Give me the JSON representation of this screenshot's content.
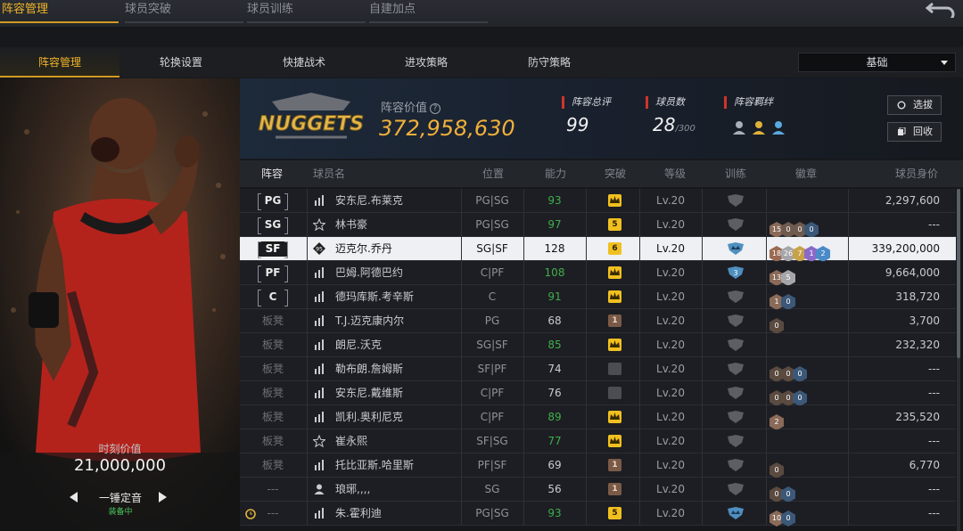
{
  "top_tabs": [
    "阵容管理",
    "球员突破",
    "球员训练",
    "自建加点"
  ],
  "sub_tabs": [
    "阵容管理",
    "轮换设置",
    "快捷战术",
    "进攻策略",
    "防守策略"
  ],
  "mode_select": {
    "value": "基础"
  },
  "card": {
    "value_label": "时刻价值",
    "value": "21,000,000",
    "skin_name": "一锤定音",
    "skin_status": "装备中"
  },
  "team": {
    "logo_text": "NUGGETS",
    "value_label": "阵容价值",
    "value": "372,958,630",
    "rating_label": "阵容总评",
    "rating": "99",
    "count_label": "球员数",
    "count": "28",
    "count_max": "/300",
    "synergy_label": "阵容羁绊",
    "btn_select": "选拔",
    "btn_recycle": "回收"
  },
  "columns": [
    "阵容",
    "球员名",
    "位置",
    "能力",
    "突破",
    "等级",
    "训练",
    "徽章",
    "球员身价"
  ],
  "colors": {
    "accent": "#f0b429",
    "green_rating": "#3fae49",
    "gold_break": "#f0c020",
    "brown_break": "#7a5a46"
  },
  "players": [
    {
      "slot": "PG",
      "starter": true,
      "type": "bars",
      "name": "安东尼.布莱克",
      "pos": "PG|SG",
      "rating": "93",
      "green": true,
      "brk": "crown",
      "level": "Lv.20",
      "train": "gray",
      "badges": [],
      "salary": "2,297,600"
    },
    {
      "slot": "SG",
      "starter": true,
      "type": "star",
      "name": "林书豪",
      "pos": "PG|SG",
      "rating": "97",
      "green": true,
      "brk": "5",
      "level": "Lv.20",
      "train": "gray",
      "badges": [
        [
          "15",
          "#8a6a58"
        ],
        [
          "0",
          "#6f5a4e"
        ],
        [
          "0",
          "#6f5a4e"
        ],
        [
          "0",
          "#3c5878"
        ]
      ],
      "salary": "---"
    },
    {
      "slot": "SF",
      "starter": true,
      "type": "special",
      "type_label": "95",
      "name": "迈克尔.乔丹",
      "pos": "SG|SF",
      "rating": "128",
      "green": false,
      "brk": "6",
      "level": "Lv.20",
      "train": "blue",
      "badges": [
        [
          "18",
          "#9b6a52"
        ],
        [
          "26",
          "#a6a6aa"
        ],
        [
          "7",
          "#c8a24a"
        ],
        [
          "1",
          "#8a6ac8"
        ],
        [
          "2",
          "#4a8ac8"
        ]
      ],
      "salary": "339,200,000",
      "selected": true
    },
    {
      "slot": "PF",
      "starter": true,
      "type": "bars",
      "name": "巴姆.阿德巴约",
      "pos": "C|PF",
      "rating": "108",
      "green": true,
      "brk": "crown",
      "level": "Lv.20",
      "train": "blue3",
      "badges": [
        [
          "13",
          "#8a6a58"
        ],
        [
          "5",
          "#a6a6aa"
        ]
      ],
      "salary": "9,664,000"
    },
    {
      "slot": "C",
      "starter": true,
      "type": "bars",
      "name": "德玛库斯.考辛斯",
      "pos": "C",
      "rating": "91",
      "green": true,
      "brk": "crown",
      "level": "Lv.20",
      "train": "gray",
      "badges": [
        [
          "1",
          "#8a6a58"
        ],
        [
          "0",
          "#3c5878"
        ]
      ],
      "salary": "318,720"
    },
    {
      "slot": "板凳",
      "starter": false,
      "type": "bars",
      "name": "T.J.迈克康内尔",
      "pos": "PG",
      "rating": "68",
      "green": false,
      "brk": "1",
      "level": "Lv.20",
      "train": "gray",
      "badges": [
        [
          "0",
          "#5a4a40"
        ]
      ],
      "salary": "3,700"
    },
    {
      "slot": "板凳",
      "starter": false,
      "type": "bars",
      "name": "朗尼.沃克",
      "pos": "SG|SF",
      "rating": "85",
      "green": true,
      "brk": "crown",
      "level": "Lv.20",
      "train": "gray",
      "badges": [],
      "salary": "232,320"
    },
    {
      "slot": "板凳",
      "starter": false,
      "type": "bars",
      "name": "勒布朗.詹姆斯",
      "pos": "SF|PF",
      "rating": "74",
      "green": false,
      "brk": "gray",
      "level": "Lv.20",
      "train": "gray",
      "badges": [
        [
          "0",
          "#5a4a40"
        ],
        [
          "0",
          "#5a4a40"
        ],
        [
          "0",
          "#3c5878"
        ]
      ],
      "salary": "---"
    },
    {
      "slot": "板凳",
      "starter": false,
      "type": "bars",
      "name": "安东尼.戴维斯",
      "pos": "C|PF",
      "rating": "76",
      "green": false,
      "brk": "gray",
      "level": "Lv.20",
      "train": "gray",
      "badges": [
        [
          "0",
          "#5a4a40"
        ],
        [
          "0",
          "#5a4a40"
        ],
        [
          "0",
          "#3c5878"
        ]
      ],
      "salary": "---"
    },
    {
      "slot": "板凳",
      "starter": false,
      "type": "bars",
      "name": "凯利.奥利尼克",
      "pos": "C|PF",
      "rating": "89",
      "green": true,
      "brk": "crown",
      "level": "Lv.20",
      "train": "gray",
      "badges": [
        [
          "2",
          "#8a6a58"
        ]
      ],
      "salary": "235,520"
    },
    {
      "slot": "板凳",
      "starter": false,
      "type": "star",
      "name": "崔永熙",
      "pos": "SF|SG",
      "rating": "77",
      "green": true,
      "brk": "crown",
      "level": "Lv.20",
      "train": "gray",
      "badges": [],
      "salary": "---"
    },
    {
      "slot": "板凳",
      "starter": false,
      "type": "bars",
      "name": "托比亚斯.哈里斯",
      "pos": "PF|SF",
      "rating": "69",
      "green": false,
      "brk": "1",
      "level": "Lv.20",
      "train": "gray",
      "badges": [
        [
          "0",
          "#5a4a40"
        ]
      ],
      "salary": "6,770"
    },
    {
      "slot": "---",
      "starter": false,
      "type": "person",
      "name": "琅琊,,,,",
      "pos": "SG",
      "rating": "56",
      "green": false,
      "brk": "1",
      "level": "Lv.20",
      "train": "gray",
      "badges": [
        [
          "0",
          "#5a4a40"
        ],
        [
          "0",
          "#3c5878"
        ]
      ],
      "salary": "---"
    },
    {
      "slot": "---",
      "starter": false,
      "type": "bars",
      "alarm": true,
      "name": "朱.霍利迪",
      "pos": "PG|SG",
      "rating": "93",
      "green": true,
      "brk": "5",
      "level": "Lv.20",
      "train": "blue",
      "badges": [
        [
          "10",
          "#8a6a58"
        ],
        [
          "0",
          "#3c5878"
        ]
      ],
      "salary": "---"
    }
  ]
}
